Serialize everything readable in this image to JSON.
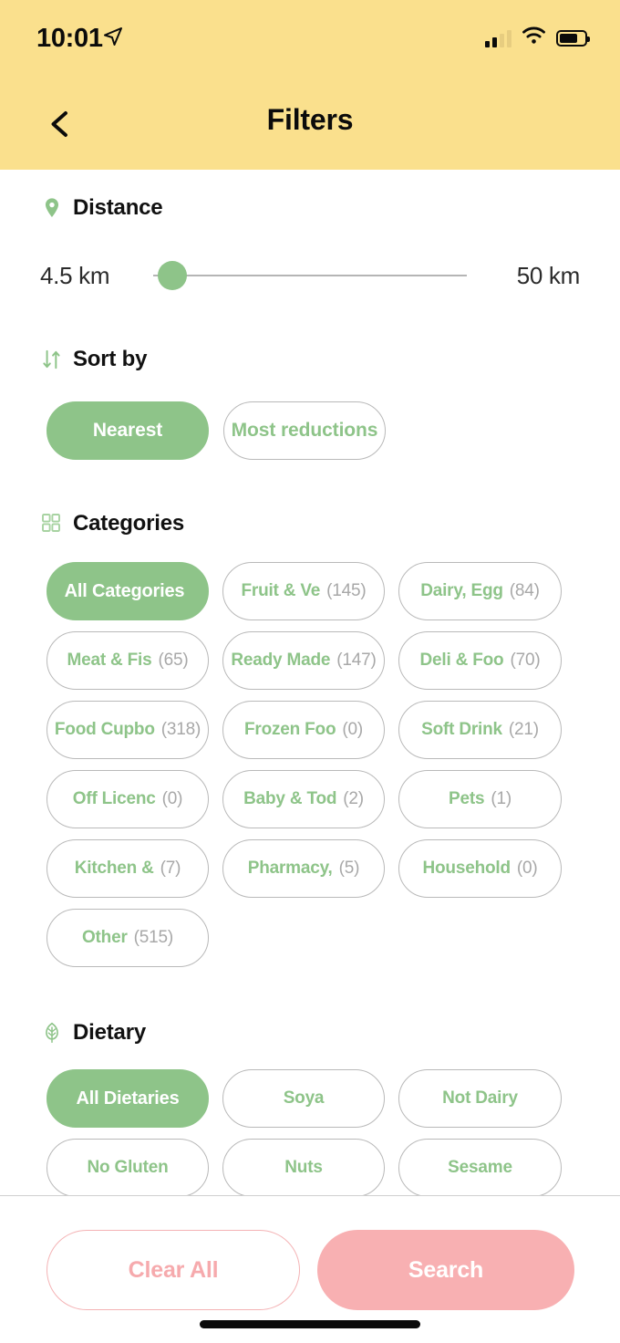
{
  "status_bar": {
    "time": "10:01",
    "location_icon": "location-arrow-icon",
    "signal_icon": "cellular-signal-icon",
    "wifi_icon": "wifi-icon",
    "battery_icon": "battery-icon"
  },
  "header": {
    "title": "Filters",
    "back_icon": "back-chevron-icon",
    "background_color": "#fae08d"
  },
  "theme": {
    "accent_green": "#8ec489",
    "accent_pink": "#f8b0b2",
    "chip_border": "#b9b9b9",
    "count_gray": "#a8a8a8"
  },
  "distance": {
    "title": "Distance",
    "icon": "map-pin-icon",
    "min_label": "4.5 km",
    "max_label": "50 km",
    "value": 4.5,
    "max_value": 50,
    "thumb_percent": 5
  },
  "sort_by": {
    "title": "Sort by",
    "icon": "sort-arrows-icon",
    "options": [
      {
        "label": "Nearest",
        "selected": true
      },
      {
        "label": "Most reductions",
        "selected": false
      }
    ]
  },
  "categories": {
    "title": "Categories",
    "icon": "grid-icon",
    "items": [
      {
        "label": "All Categories",
        "count": "",
        "selected": true
      },
      {
        "label": "Fruit & Ve",
        "count": "(145)",
        "selected": false
      },
      {
        "label": "Dairy, Egg",
        "count": "(84)",
        "selected": false
      },
      {
        "label": "Meat & Fis",
        "count": "(65)",
        "selected": false
      },
      {
        "label": "Ready Made",
        "count": "(147)",
        "selected": false
      },
      {
        "label": "Deli & Foo",
        "count": "(70)",
        "selected": false
      },
      {
        "label": "Food Cupbo",
        "count": "(318)",
        "selected": false
      },
      {
        "label": "Frozen Foo",
        "count": "(0)",
        "selected": false
      },
      {
        "label": "Soft Drink",
        "count": "(21)",
        "selected": false
      },
      {
        "label": "Off Licenc",
        "count": "(0)",
        "selected": false
      },
      {
        "label": "Baby & Tod",
        "count": "(2)",
        "selected": false
      },
      {
        "label": "Pets",
        "count": "(1)",
        "selected": false
      },
      {
        "label": "Kitchen &",
        "count": "(7)",
        "selected": false
      },
      {
        "label": "Pharmacy,",
        "count": "(5)",
        "selected": false
      },
      {
        "label": "Household",
        "count": "(0)",
        "selected": false
      },
      {
        "label": "Other",
        "count": "(515)",
        "selected": false
      }
    ]
  },
  "dietary": {
    "title": "Dietary",
    "icon": "leaf-icon",
    "items": [
      {
        "label": "All Dietaries",
        "selected": true
      },
      {
        "label": "Soya",
        "selected": false
      },
      {
        "label": "Not Dairy",
        "selected": false
      },
      {
        "label": "No Gluten",
        "selected": false
      },
      {
        "label": "Nuts",
        "selected": false
      },
      {
        "label": "Sesame",
        "selected": false
      }
    ]
  },
  "footer": {
    "clear_label": "Clear All",
    "search_label": "Search"
  }
}
